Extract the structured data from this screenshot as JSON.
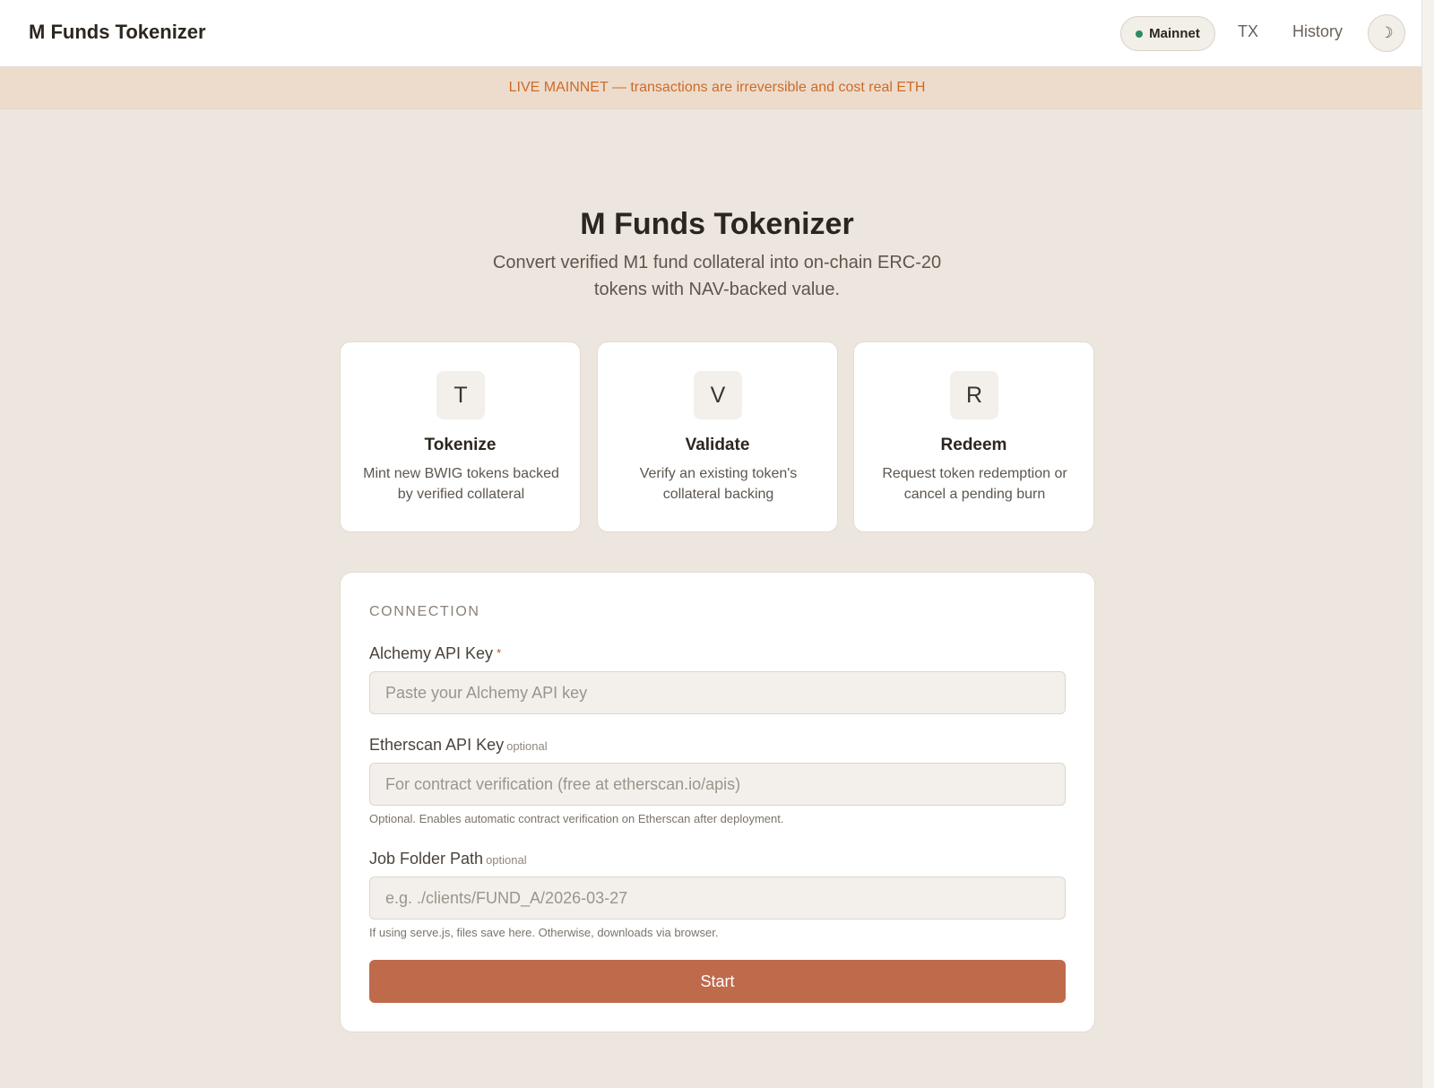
{
  "header": {
    "title": "M Funds Tokenizer",
    "network_label": "Mainnet",
    "nav": [
      "TX",
      "History"
    ],
    "theme_icon": "moon-icon"
  },
  "banner": {
    "text": "LIVE MAINNET — transactions are irreversible and cost real ETH"
  },
  "hero": {
    "title": "M Funds Tokenizer",
    "subtitle": "Convert verified M1 fund collateral into on-chain ERC-20 tokens with NAV-backed value."
  },
  "actions": [
    {
      "letter": "T",
      "title": "Tokenize",
      "description": "Mint new BWIG tokens backed by verified collateral"
    },
    {
      "letter": "V",
      "title": "Validate",
      "description": "Verify an existing token's collateral backing"
    },
    {
      "letter": "R",
      "title": "Redeem",
      "description": "Request token redemption or cancel a pending burn"
    }
  ],
  "connection": {
    "section_title": "CONNECTION",
    "alchemy": {
      "label": "Alchemy API Key",
      "required_mark": "*",
      "placeholder": "Paste your Alchemy API key",
      "value": ""
    },
    "etherscan": {
      "label": "Etherscan API Key",
      "optional_tag": "optional",
      "placeholder": "For contract verification (free at etherscan.io/apis)",
      "value": "",
      "hint": "Optional. Enables automatic contract verification on Etherscan after deployment."
    },
    "job_folder": {
      "label": "Job Folder Path",
      "optional_tag": "optional",
      "placeholder": "e.g. ./clients/FUND_A/2026-03-27",
      "value": "",
      "hint": "If using serve.js, files save here. Otherwise, downloads via browser."
    },
    "start_label": "Start"
  },
  "colors": {
    "accent": "#bf6a4b",
    "banner_text": "#cd6b2a",
    "status_dot": "#2e8b5e",
    "background": "#ece6de"
  }
}
